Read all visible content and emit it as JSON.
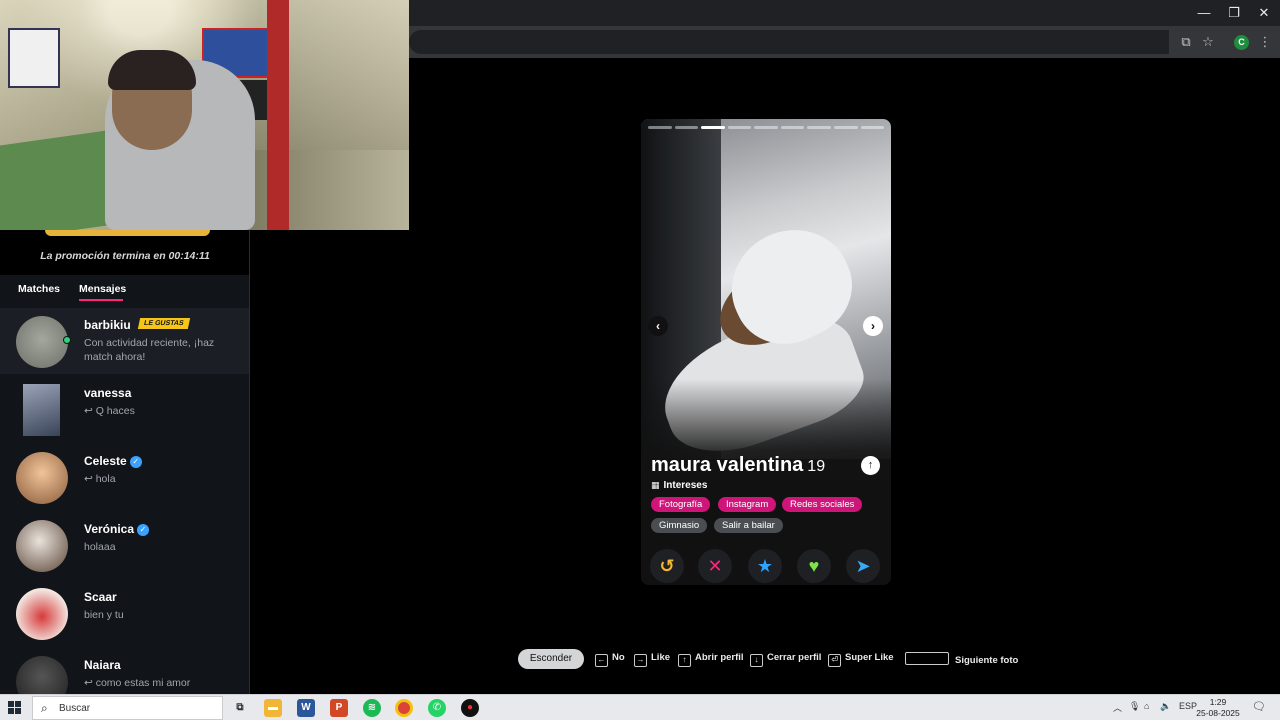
{
  "browser": {
    "window_controls": {
      "minimize": "—",
      "restore": "❐",
      "close": "✕"
    },
    "profile_initial": "C"
  },
  "sidebar": {
    "promo": "La promoción termina en 00:14:11",
    "tabs": [
      {
        "label": "Matches"
      },
      {
        "label": "Mensajes"
      }
    ],
    "conversations": [
      {
        "name": "barbikiu",
        "badge": "LE GUSTAS",
        "line1": "Con actividad reciente, ¡haz",
        "line2": "match ahora!",
        "verified": false,
        "online": true,
        "avatar_color": "#8a8f86"
      },
      {
        "name": "vanessa",
        "line1": "↩ Q haces",
        "verified": false,
        "avatar_color": "#5a6a88"
      },
      {
        "name": "Celeste",
        "line1": "↩ hola",
        "verified": true,
        "avatar_color": "#c79a6e"
      },
      {
        "name": "Verónica",
        "line1": "holaaa",
        "verified": true,
        "avatar_color": "#7e6656"
      },
      {
        "name": "Scaar",
        "line1": "bien y tu",
        "verified": false,
        "avatar_color": "#c83a3a"
      },
      {
        "name": "Naiara",
        "line1": "↩ como estas mi amor",
        "verified": false,
        "avatar_color": "#333333"
      }
    ]
  },
  "profile": {
    "name": "maura valentina",
    "age": "19",
    "interests_label": "Intereses",
    "interests": [
      "Fotografía",
      "Instagram",
      "Redes sociales",
      "Gimnasio",
      "Salir a bailar"
    ],
    "photo_count": 9,
    "current_photo": 3,
    "actions": [
      {
        "name": "rewind",
        "glyph": "↺",
        "color": "#f5b82e"
      },
      {
        "name": "nope",
        "glyph": "✕",
        "color": "#fd267d"
      },
      {
        "name": "super-like",
        "glyph": "★",
        "color": "#2ea3ff"
      },
      {
        "name": "like",
        "glyph": "♥",
        "color": "#7ee34a"
      },
      {
        "name": "boost",
        "glyph": "➤",
        "color": "#3aa8f5"
      }
    ]
  },
  "shortcuts": {
    "hide": "Esconder",
    "items": [
      {
        "key": "←",
        "label": "No"
      },
      {
        "key": "→",
        "label": "Like"
      },
      {
        "key": "↑",
        "label": "Abrir perfil"
      },
      {
        "key": "↓",
        "label": "Cerrar perfil"
      },
      {
        "key": "⏎",
        "label": "Super Like"
      },
      {
        "key": "",
        "label": "Siguiente foto"
      }
    ]
  },
  "taskbar": {
    "search_placeholder": "Buscar",
    "lang": "ESP",
    "time": "1:29",
    "date": "25-08-2025"
  },
  "colors": {
    "accent": "#fd267d",
    "promo_gold": "#e8b33a"
  }
}
